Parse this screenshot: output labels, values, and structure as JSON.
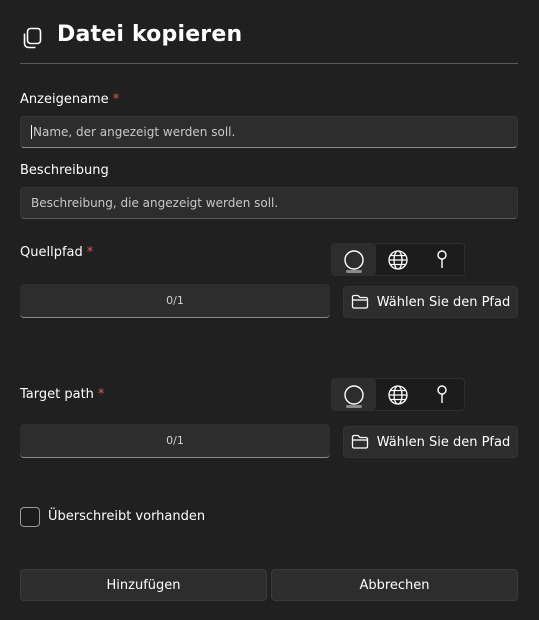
{
  "dialog": {
    "title": "Datei kopieren",
    "title_icon": "copy-icon"
  },
  "display_name": {
    "label": "Anzeigename",
    "required_mark": "*",
    "placeholder": "Name, der angezeigt werden soll."
  },
  "description": {
    "label": "Beschreibung",
    "placeholder": "Beschreibung, die angezeigt werden soll."
  },
  "source_path": {
    "label": "Quellpfad",
    "required_mark": "*",
    "value": "0/1",
    "choose_button": "Wählen Sie den Pfad",
    "modes": [
      "circle-icon",
      "globe-icon",
      "pin-icon"
    ],
    "active_mode": "circle-icon"
  },
  "target_path": {
    "label": "Target path",
    "required_mark": "*",
    "value": "0/1",
    "choose_button": "Wählen Sie den Pfad",
    "modes": [
      "circle-icon",
      "globe-icon",
      "pin-icon"
    ],
    "active_mode": "circle-icon"
  },
  "overwrite": {
    "label": "Überschreibt vorhanden",
    "checked": false
  },
  "footer": {
    "add_button": "Hinzufügen",
    "cancel_button": "Abbrechen"
  },
  "colors": {
    "background": "#202020",
    "control": "#2d2d2d",
    "required": "#e05a5a"
  }
}
